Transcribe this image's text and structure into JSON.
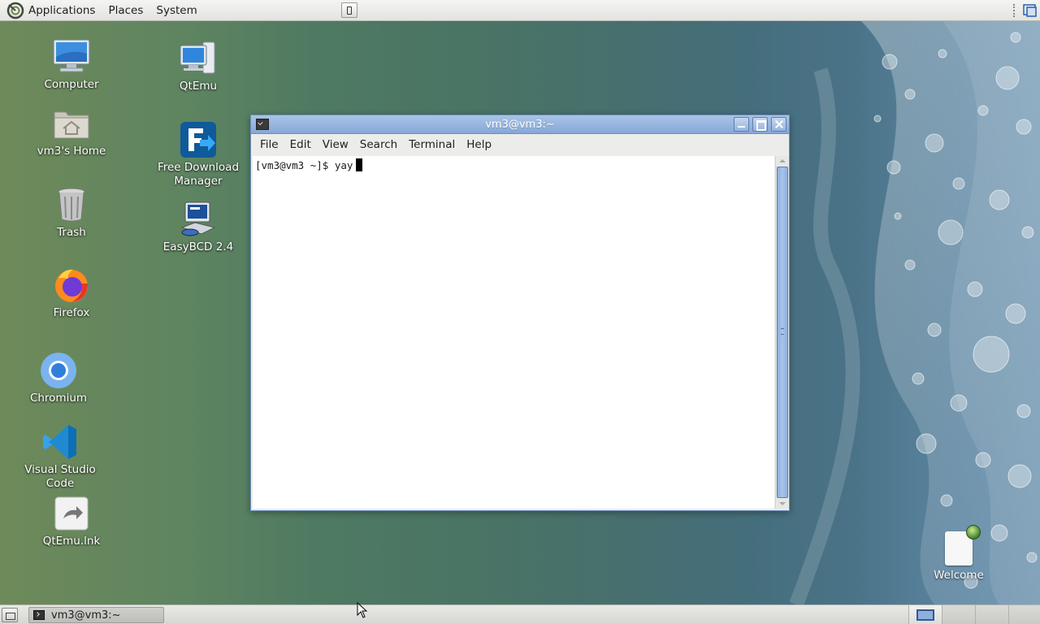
{
  "top_panel": {
    "menus": [
      "Applications",
      "Places",
      "System"
    ]
  },
  "desktop_icons": {
    "computer": "Computer",
    "home": "vm3's Home",
    "trash": "Trash",
    "firefox": "Firefox",
    "chromium": "Chromium",
    "vscode": "Visual Studio Code",
    "qtemu_lnk": "QtEmu.lnk",
    "qtemu": "QtEmu",
    "fdm_line1": "Free Download",
    "fdm_line2": "Manager",
    "easybcd": "EasyBCD 2.4",
    "welcome": "Welcome"
  },
  "terminal": {
    "title": "vm3@vm3:~",
    "menu": [
      "File",
      "Edit",
      "View",
      "Search",
      "Terminal",
      "Help"
    ],
    "prompt": "[vm3@vm3 ~]$ yay"
  },
  "bottom_panel": {
    "task_label": "vm3@vm3:~",
    "workspace_count": 4,
    "active_workspace": 1
  },
  "colors": {
    "titlebar": "#94b2dc",
    "scroll_thumb": "#9ab8e4"
  }
}
